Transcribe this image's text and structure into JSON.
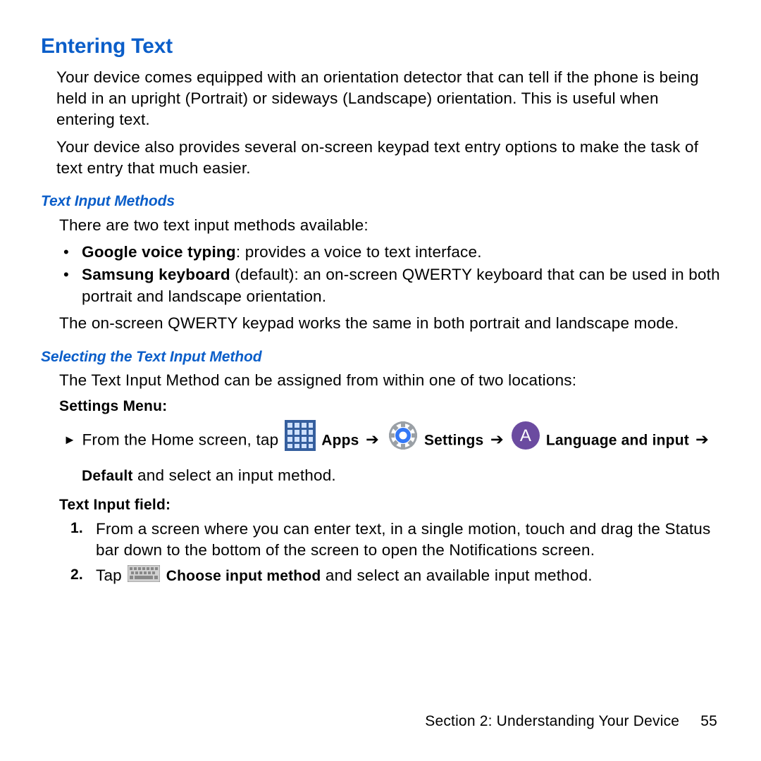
{
  "h1": "Entering Text",
  "intro1": "Your device comes equipped with an orientation detector that can tell if the phone is being held in an upright (Portrait) or sideways (Landscape) orientation. This is useful when entering text.",
  "intro2": "Your device also provides several on-screen keypad text entry options to make the task of text entry that much easier.",
  "h2a": "Text Input Methods",
  "methods_lead": "There are two text input methods available:",
  "m1_name": "Google voice typing",
  "m1_desc": ": provides a voice to text interface.",
  "m2_name": "Samsung keyboard",
  "m2_qual": " (default): an on-screen QWERTY keyboard that can be used in both portrait and landscape orientation.",
  "methods_note": "The on-screen QWERTY keypad works the same in both portrait and landscape mode.",
  "h2b": "Selecting the Text Input Method",
  "select_lead": "The Text Input Method can be assigned from within one of two locations:",
  "settings_label": "Settings Menu:",
  "step_from": "From the Home screen, tap ",
  "apps_label": " Apps",
  "settings_label2": " Settings",
  "lang_input": " Language and input ",
  "default_word": "Default",
  "tail": " and select an input method.",
  "arrow": "➔",
  "text_input_label": "Text Input field:",
  "step1": "From a screen where you can enter text, in a single motion, touch and drag the Status bar down to the bottom of the screen to open the Notifications screen.",
  "step2a": "Tap ",
  "step2b": " Choose input method",
  "step2c": " and select an available input method.",
  "footer_section": "Section 2:  Understanding Your Device",
  "footer_page": "55"
}
